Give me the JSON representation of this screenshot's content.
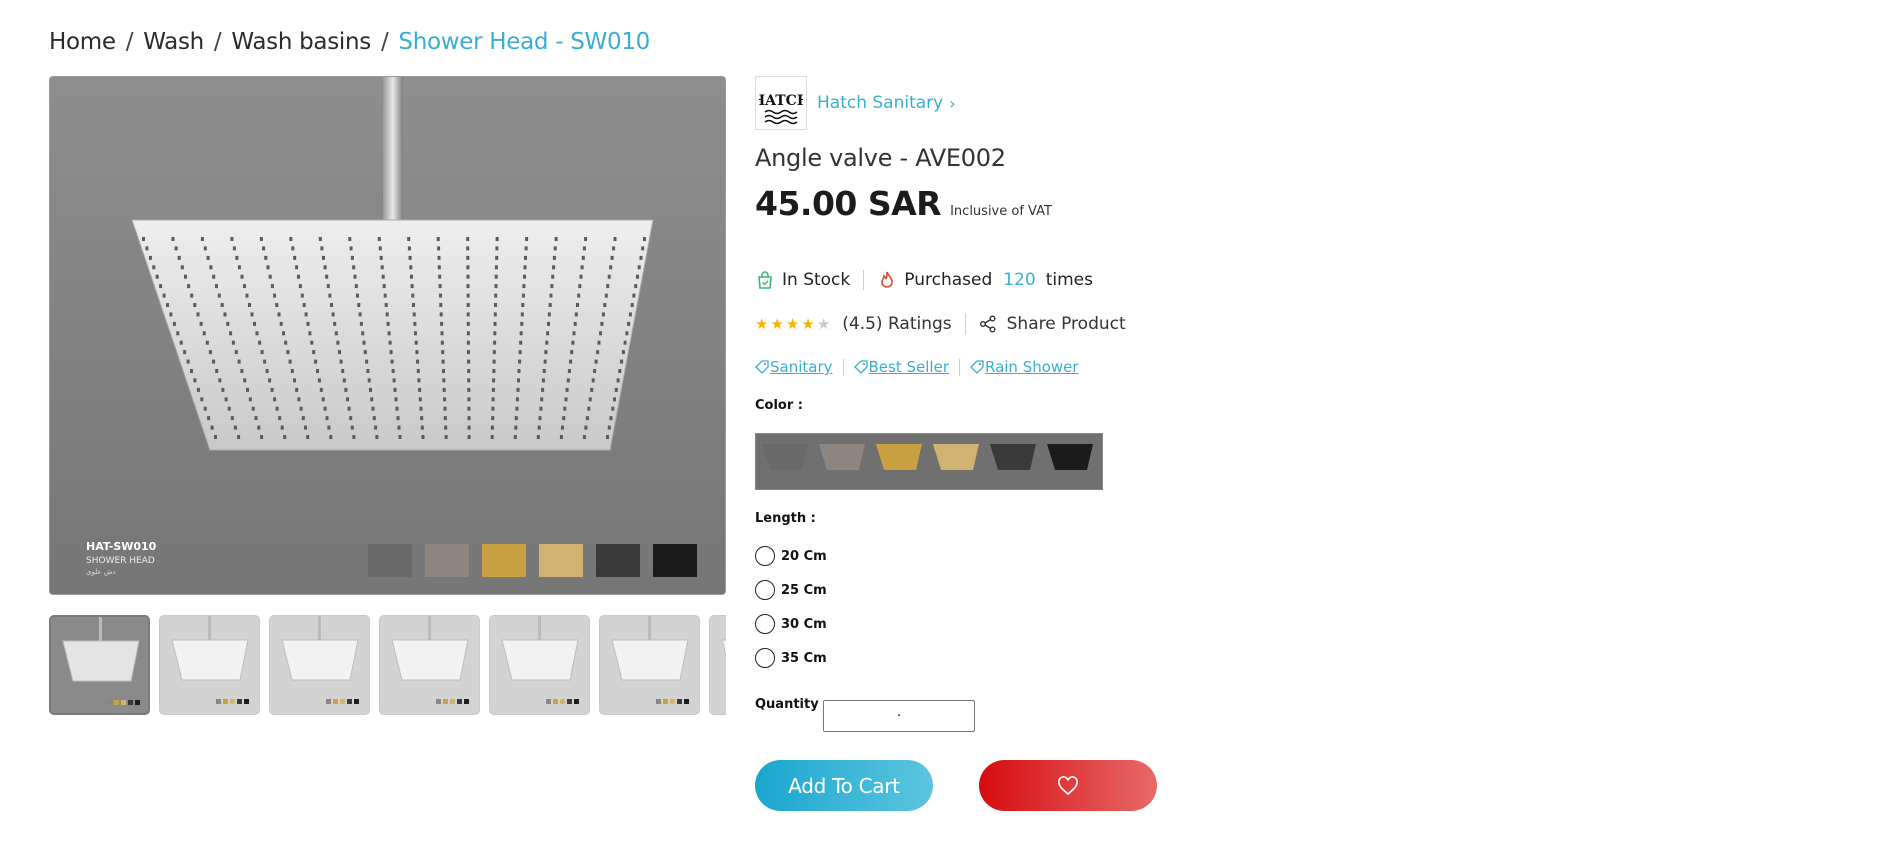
{
  "breadcrumb": {
    "items": [
      "Home",
      "Wash",
      "Wash basins"
    ],
    "separator": "/",
    "current": "Shower Head - SW010"
  },
  "gallery": {
    "main_caption": {
      "code": "HAT-SW010",
      "name": "SHOWER HEAD",
      "arabic": "دش علوي"
    },
    "finish_swatch_colors": [
      "#6a6a6a",
      "#8d8580",
      "#c9a042",
      "#d2b270",
      "#3a3a3a",
      "#1c1c1c"
    ],
    "thumbnail_count": 7
  },
  "brand": {
    "name": "Hatch Sanitary",
    "logo_text": "HATCH"
  },
  "product": {
    "title": "Angle valve - AVE002",
    "price": "45.00 SAR",
    "vat_note": "Inclusive of VAT"
  },
  "stock": {
    "status": "In Stock",
    "purchased_label": "Purchased",
    "purchased_count": "120",
    "times_label": "times"
  },
  "rating": {
    "value": 4.5,
    "max": 5,
    "label": "(4.5) Ratings",
    "share_label": "Share Product"
  },
  "tags": [
    "Sanitary",
    "Best Seller",
    "Rain Shower"
  ],
  "options": {
    "color_label": "Color :",
    "length_label": "Length :",
    "lengths": [
      "20 Cm",
      "25 Cm",
      "30 Cm",
      "35 Cm"
    ]
  },
  "quantity": {
    "label": "Quantity",
    "value": "·"
  },
  "actions": {
    "add_to_cart": "Add To Cart"
  },
  "colors": {
    "accent": "#3aaecf",
    "cart_gradient": [
      "#1aa6cf",
      "#5cc5de"
    ],
    "wish_gradient": [
      "#d60c10",
      "#e86a6a"
    ],
    "star_filled": "#f5b301",
    "star_empty": "#c8c8c8"
  }
}
